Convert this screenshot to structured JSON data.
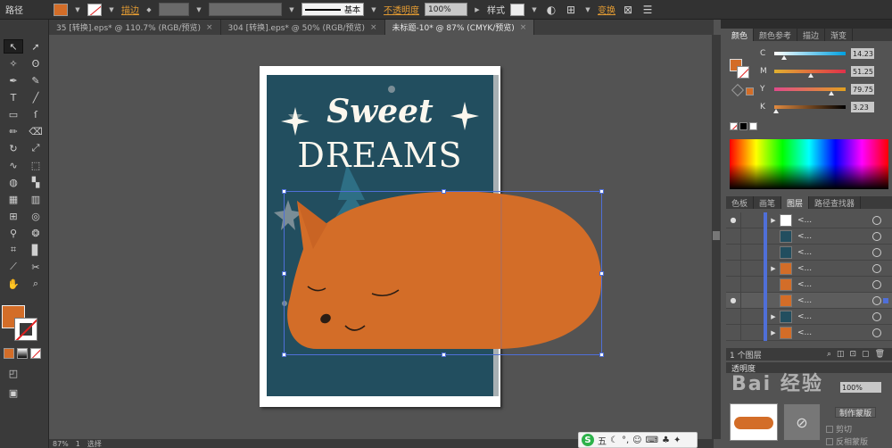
{
  "control_bar": {
    "object_type": "路径",
    "stroke_label": "描边",
    "stroke_style": "基本",
    "opacity_label": "不透明度",
    "opacity_value": "100%",
    "style_label": "样式",
    "transform_label": "变换",
    "fill_color": "#d36d28"
  },
  "tabs": [
    {
      "label": "35 [转换].eps* @ 110.7% (RGB/预览)",
      "active": false
    },
    {
      "label": "304 [转换].eps* @ 50% (RGB/预览)",
      "active": false
    },
    {
      "label": "未标题-10* @ 87% (CMYK/预览)",
      "active": true
    }
  ],
  "artwork": {
    "title_line1": "Sweet",
    "title_line2": "DREAMS",
    "bg_color": "#224e5f",
    "fox_color": "#d36d28"
  },
  "color_panel": {
    "tabs": [
      "颜色",
      "颜色参考",
      "描边",
      "渐变"
    ],
    "channels": [
      {
        "name": "C",
        "value": "14.23",
        "level": 0.14
      },
      {
        "name": "M",
        "value": "51.25",
        "level": 0.51
      },
      {
        "name": "Y",
        "value": "79.75",
        "level": 0.8
      },
      {
        "name": "K",
        "value": "3.23",
        "level": 0.03
      }
    ]
  },
  "layers_panel": {
    "tabs": [
      "色板",
      "画笔",
      "图层",
      "路径查找器"
    ],
    "rows": [
      {
        "name": "<...",
        "eye": true,
        "expand": true
      },
      {
        "name": "<...",
        "eye": false,
        "expand": false
      },
      {
        "name": "<...",
        "eye": false,
        "expand": false
      },
      {
        "name": "<...",
        "eye": false,
        "expand": true
      },
      {
        "name": "<...",
        "eye": false,
        "expand": false
      },
      {
        "name": "<...",
        "eye": true,
        "expand": false,
        "selected": true
      },
      {
        "name": "<...",
        "eye": false,
        "expand": true
      },
      {
        "name": "<...",
        "eye": false,
        "expand": true
      }
    ],
    "footer": "1 个图层"
  },
  "transparency_panel": {
    "title": "透明度",
    "opacity": "100%",
    "make_mask": "制作蒙版",
    "clip": "剪切",
    "invert_mask": "反相蒙版"
  },
  "status_bar": {
    "zoom": "87%",
    "page": "1",
    "tool": "选择"
  },
  "watermark": "Bai 经验",
  "ime": {
    "label": "五"
  }
}
